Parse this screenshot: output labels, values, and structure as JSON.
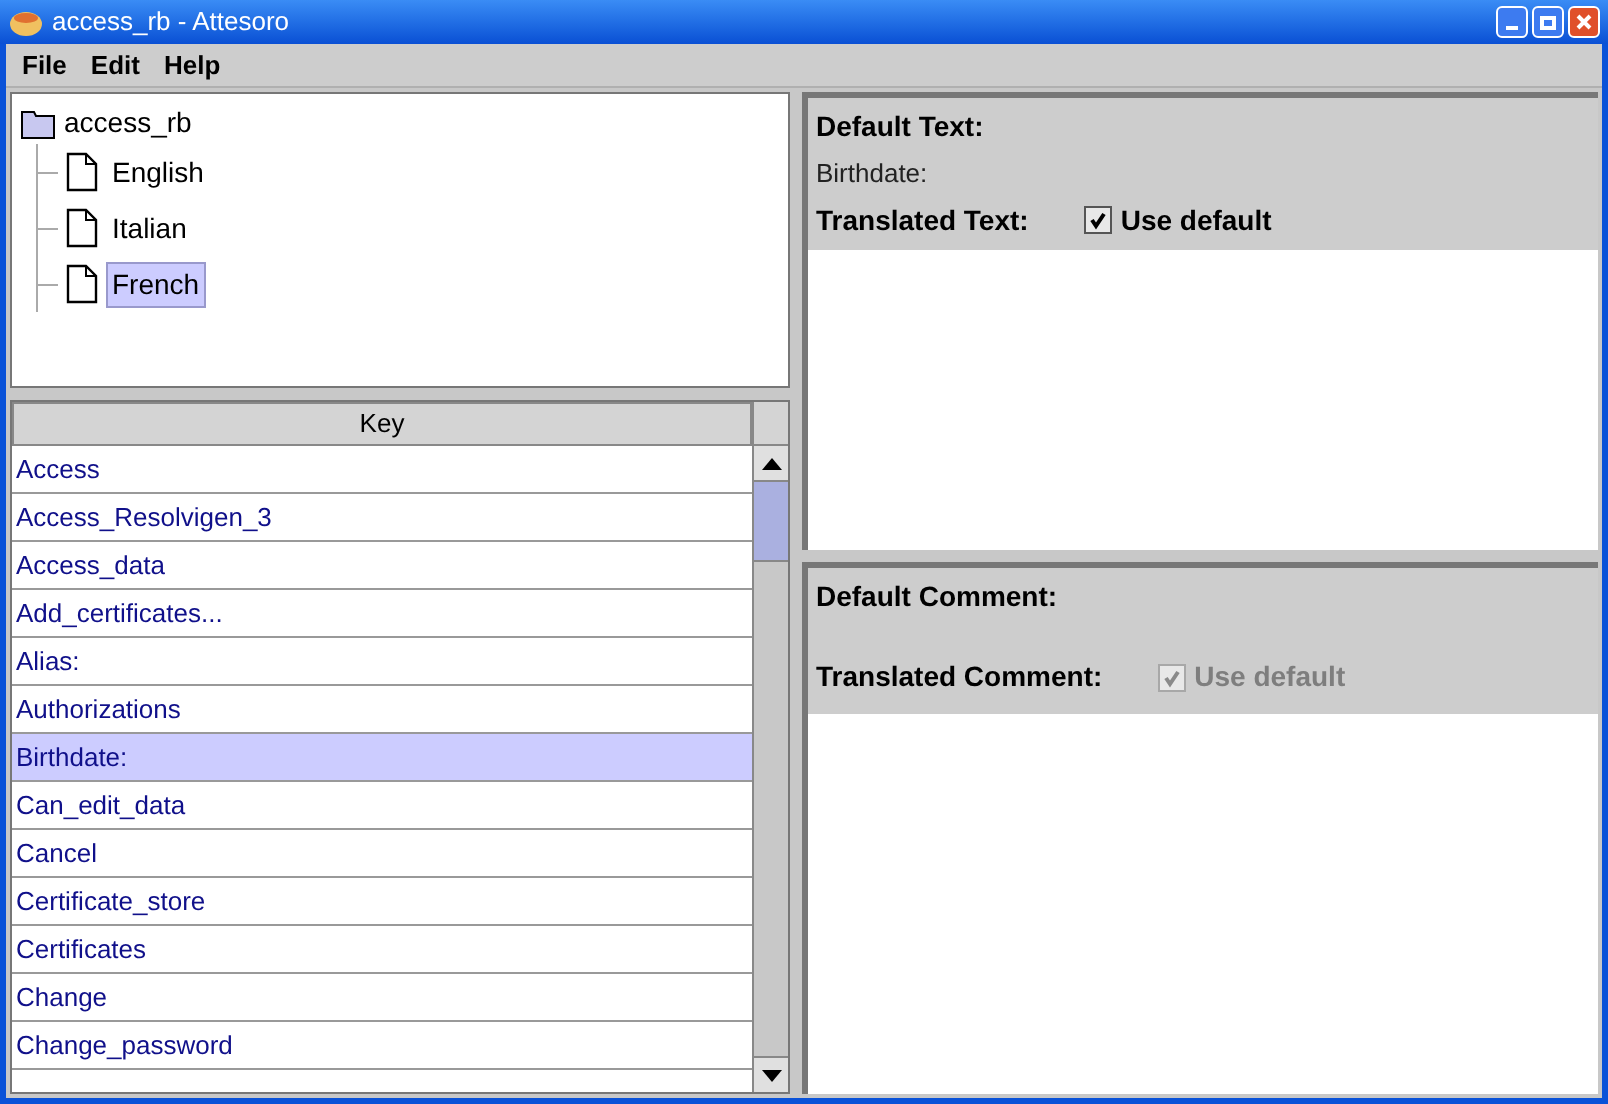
{
  "window": {
    "title": "access_rb - Attesoro"
  },
  "menu": [
    "File",
    "Edit",
    "Help"
  ],
  "tree": {
    "label": "access_rb",
    "children": [
      {
        "label": "English",
        "selected": false
      },
      {
        "label": "Italian",
        "selected": false
      },
      {
        "label": "French",
        "selected": true
      }
    ]
  },
  "table": {
    "columns": [
      "Key"
    ],
    "rows": [
      {
        "key": "Access",
        "selected": false
      },
      {
        "key": "Access_Resolvigen_3",
        "selected": false
      },
      {
        "key": "Access_data",
        "selected": false
      },
      {
        "key": "Add_certificates...",
        "selected": false
      },
      {
        "key": "Alias:",
        "selected": false
      },
      {
        "key": "Authorizations",
        "selected": false
      },
      {
        "key": "Birthdate:",
        "selected": true
      },
      {
        "key": "Can_edit_data",
        "selected": false
      },
      {
        "key": "Cancel",
        "selected": false
      },
      {
        "key": "Certificate_store",
        "selected": false
      },
      {
        "key": "Certificates",
        "selected": false
      },
      {
        "key": "Change",
        "selected": false
      },
      {
        "key": "Change_password",
        "selected": false
      }
    ]
  },
  "text_panel": {
    "default_label": "Default Text:",
    "default_value": "Birthdate:",
    "translated_label": "Translated Text:",
    "use_default": {
      "label": "Use default",
      "checked": true,
      "disabled": false
    }
  },
  "comment_panel": {
    "default_label": "Default Comment:",
    "translated_label": "Translated Comment:",
    "use_default": {
      "label": "Use default",
      "checked": true,
      "disabled": true
    }
  }
}
